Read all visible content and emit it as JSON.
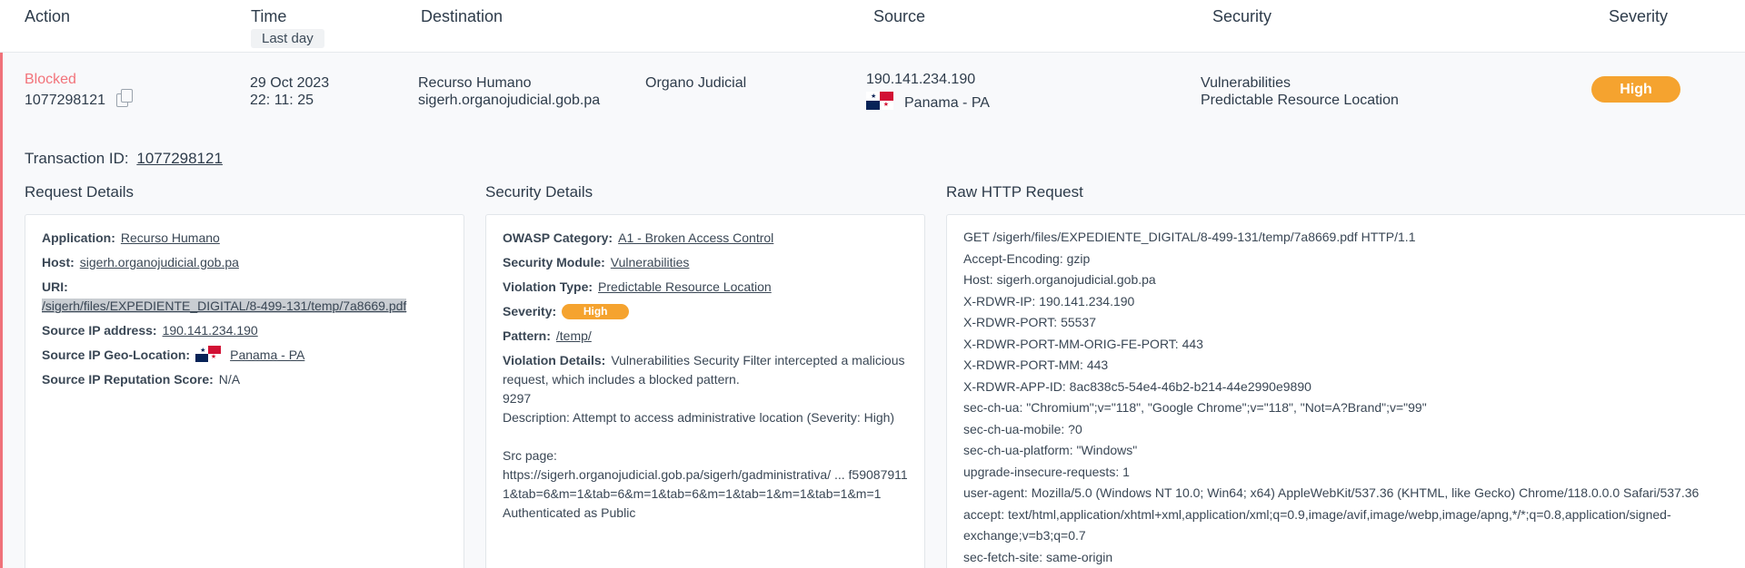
{
  "columns": {
    "action": "Action",
    "time": "Time",
    "destination": "Destination",
    "source": "Source",
    "security": "Security",
    "severity": "Severity"
  },
  "time_filter": "Last day",
  "event": {
    "status": "Blocked",
    "id": "1077298121",
    "date": "29 Oct 2023",
    "time": "22: 11: 25",
    "app": "Recurso Humano",
    "host": "sigerh.organojudicial.gob.pa",
    "org": "Organo Judicial",
    "source_ip": "190.141.234.190",
    "source_geo": "Panama - PA",
    "security_module": "Vulnerabilities",
    "violation": "Predictable Resource Location",
    "severity": "High"
  },
  "transaction": {
    "label": "Transaction ID:",
    "id": "1077298121"
  },
  "request_details": {
    "title": "Request Details",
    "application_label": "Application:",
    "application": "Recurso Humano",
    "host_label": "Host:",
    "host": "sigerh.organojudicial.gob.pa",
    "uri_label": "URI:",
    "uri": "/sigerh/files/EXPEDIENTE_DIGITAL/8-499-131/temp/7a8669.pdf",
    "source_ip_label": "Source IP address:",
    "source_ip": "190.141.234.190",
    "geo_label": "Source IP Geo-Location:",
    "geo": "Panama - PA",
    "reputation_label": "Source IP Reputation Score:",
    "reputation": "N/A"
  },
  "security_details": {
    "title": "Security Details",
    "owasp_label": "OWASP Category:",
    "owasp": "A1 - Broken Access Control",
    "module_label": "Security Module:",
    "module": "Vulnerabilities",
    "violation_label": "Violation Type:",
    "violation": "Predictable Resource Location",
    "severity_label": "Severity:",
    "severity": "High",
    "pattern_label": "Pattern:",
    "pattern": "/temp/",
    "details_label": "Violation Details:",
    "details_intro": "Vulnerabilities Security Filter intercepted a malicious request, which includes a blocked pattern.",
    "details_body": "9297\nDescription: Attempt to access administrative location (Severity: High)\n\nSrc page:\nhttps://sigerh.organojudicial.gob.pa/sigerh/gadministrativa/ ... f590879111&tab=6&m=1&tab=6&m=1&tab=6&m=1&tab=1&m=1&tab=1&m=1\nAuthenticated as Public"
  },
  "raw_http": {
    "title": "Raw HTTP Request",
    "lines": [
      "GET /sigerh/files/EXPEDIENTE_DIGITAL/8-499-131/temp/7a8669.pdf HTTP/1.1",
      "Accept-Encoding: gzip",
      "Host: sigerh.organojudicial.gob.pa",
      "X-RDWR-IP: 190.141.234.190",
      "X-RDWR-PORT: 55537",
      "X-RDWR-PORT-MM-ORIG-FE-PORT: 443",
      "X-RDWR-PORT-MM: 443",
      "X-RDWR-APP-ID: 8ac838c5-54e4-46b2-b214-44e2990e9890",
      "sec-ch-ua: \"Chromium\";v=\"118\", \"Google Chrome\";v=\"118\", \"Not=A?Brand\";v=\"99\"",
      "sec-ch-ua-mobile: ?0",
      "sec-ch-ua-platform: \"Windows\"",
      "upgrade-insecure-requests: 1",
      "user-agent: Mozilla/5.0 (Windows NT 10.0; Win64; x64) AppleWebKit/537.36 (KHTML, like Gecko) Chrome/118.0.0.0 Safari/537.36",
      "accept: text/html,application/xhtml+xml,application/xml;q=0.9,image/avif,image/webp,image/apng,*/*;q=0.8,application/signed-exchange;v=b3;q=0.7",
      "sec-fetch-site: same-origin"
    ]
  },
  "colors": {
    "blocked": "#f2737a",
    "severity_high": "#f5a32f",
    "row_accent": "#f0727a"
  },
  "icons": [
    "copy-icon",
    "panama-flag-icon"
  ]
}
